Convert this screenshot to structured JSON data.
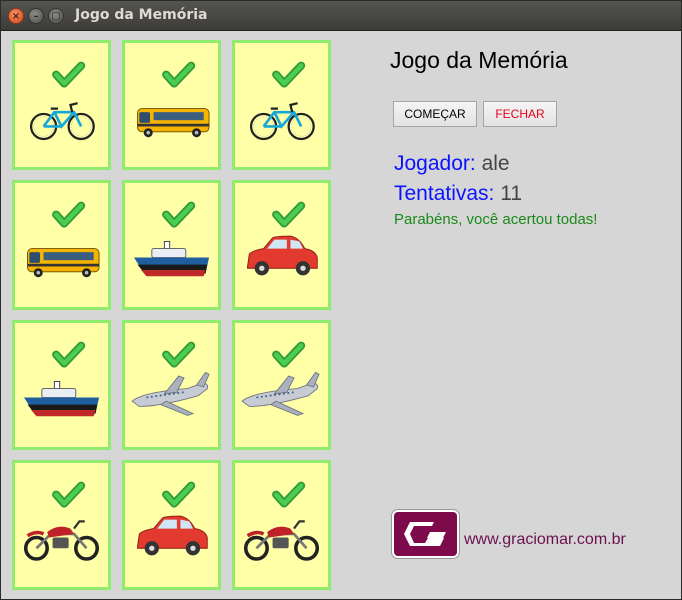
{
  "window": {
    "title": "Jogo da Memória"
  },
  "app": {
    "heading": "Jogo da Memória",
    "start_label": "COMEÇAR",
    "close_label": "FECHAR",
    "player_label": "Jogador:",
    "player_value": "ale",
    "tries_label": "Tentativas:",
    "tries_value": "11",
    "message": "Parabéns, você acertou todas!",
    "site": "www.graciomar.com.br"
  },
  "cards": [
    [
      "bicycle-icon",
      "bus-icon",
      "bicycle-icon"
    ],
    [
      "bus-icon",
      "boat-icon",
      "car-icon"
    ],
    [
      "boat-icon",
      "airplane-icon",
      "airplane-icon"
    ],
    [
      "motorcycle-icon",
      "car-icon",
      "motorcycle-icon"
    ]
  ],
  "colors": {
    "card_bg": "#ffffa8",
    "card_border": "#8fec6c",
    "check": "#3cb843",
    "label_blue": "#0a14ff",
    "message_green": "#1a8a1a",
    "close_red": "#e8001c",
    "brand": "#7d0b4b"
  }
}
